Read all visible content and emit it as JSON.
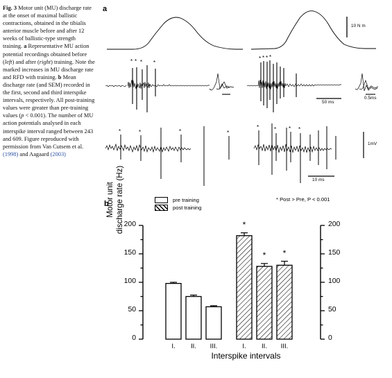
{
  "caption": {
    "fig_label": "Fig. 3",
    "text_runs": [
      {
        "t": "Fig. 3",
        "s": "b"
      },
      {
        "t": "  Motor unit (MU) discharge rate at the onset of maximal ballistic contractions, obtained in the tibialis anterior muscle before and after 12 weeks of ballistic-type strength training. ",
        "s": "n"
      },
      {
        "t": "a",
        "s": "b"
      },
      {
        "t": " Representative MU action potential recordings obtained before (",
        "s": "n"
      },
      {
        "t": "left",
        "s": "i"
      },
      {
        "t": ") and after (",
        "s": "n"
      },
      {
        "t": "right",
        "s": "i"
      },
      {
        "t": ") training. Note the marked increases in MU discharge rate and RFD with training. ",
        "s": "n"
      },
      {
        "t": "b",
        "s": "b"
      },
      {
        "t": " Mean discharge rate (and SEM) recorded in the first, second and third interspike intervals, respectively. All post-training values were greater than pre-training values (",
        "s": "n"
      },
      {
        "t": "p",
        "s": "i"
      },
      {
        "t": " < 0.001). The number of MU action potentials analysed in each interspike interval ranged between 243 and 609. Figure reproduced with permission from Van Cutsem et al. ",
        "s": "n"
      },
      {
        "t": "(1998)",
        "s": "r"
      },
      {
        "t": " and Aagaard ",
        "s": "n"
      },
      {
        "t": "(2003)",
        "s": "r"
      }
    ]
  },
  "panel_a": {
    "label": "a",
    "force_scale_label": "10 N m",
    "time_scale_label": "50 ms",
    "ap_scale_label": "0.5ms",
    "voltage_scale_label": "1mV",
    "time_scale_label_bottom": "10 ms",
    "asterisk": "*"
  },
  "panel_b": {
    "label": "b",
    "legend": [
      {
        "key": "open",
        "label": "pre training"
      },
      {
        "key": "hatched",
        "label": "post training"
      }
    ],
    "significance_note": "* Post > Pre, P < 0.001"
  },
  "chart_data": {
    "type": "bar",
    "title": "",
    "xlabel": "Interspike intervals",
    "ylabel": "Motor unit discharge rate  (Hz)",
    "ylabel_line1": "Motor unit",
    "ylabel_line2": "discharge rate  (Hz)",
    "ylim": [
      0,
      200
    ],
    "yticks": [
      0,
      50,
      100,
      150,
      200
    ],
    "ytick_labels": [
      "0",
      "50",
      "100",
      "150",
      "200"
    ],
    "yticks_right": [
      0,
      50,
      100,
      150,
      200
    ],
    "ytick_labels_right": [
      "0",
      "50",
      "100",
      "150",
      "200"
    ],
    "yminor_step": 25,
    "grid": false,
    "legend_position": "top-center",
    "categories": [
      "I.",
      "II.",
      "III.",
      "I.",
      "II.",
      "III."
    ],
    "series": [
      {
        "name": "pre training",
        "fill": "open",
        "categories": [
          "I.",
          "II.",
          "III."
        ],
        "values": [
          98,
          75,
          57
        ],
        "errors": [
          2,
          2.5,
          1.8
        ],
        "significant": [
          false,
          false,
          false
        ]
      },
      {
        "name": "post training",
        "fill": "hatched",
        "categories": [
          "I.",
          "II.",
          "III."
        ],
        "values": [
          182,
          128,
          130
        ],
        "errors": [
          5,
          5,
          7
        ],
        "significant": [
          true,
          true,
          true
        ]
      }
    ],
    "bars": [
      {
        "label": "I.",
        "group": "pre",
        "value": 98,
        "error": 2,
        "star": false
      },
      {
        "label": "II.",
        "group": "pre",
        "value": 75,
        "error": 2.5,
        "star": false
      },
      {
        "label": "III.",
        "group": "pre",
        "value": 57,
        "error": 1.8,
        "star": false
      },
      {
        "label": "I.",
        "group": "post",
        "value": 182,
        "error": 5,
        "star": true
      },
      {
        "label": "II.",
        "group": "post",
        "value": 128,
        "error": 5,
        "star": true
      },
      {
        "label": "III.",
        "group": "post",
        "value": 130,
        "error": 7,
        "star": true
      }
    ],
    "star_symbol": "*"
  },
  "colors": {
    "ink": "#000000",
    "reference_link": "#2b4fa2",
    "background": "#ffffff"
  }
}
